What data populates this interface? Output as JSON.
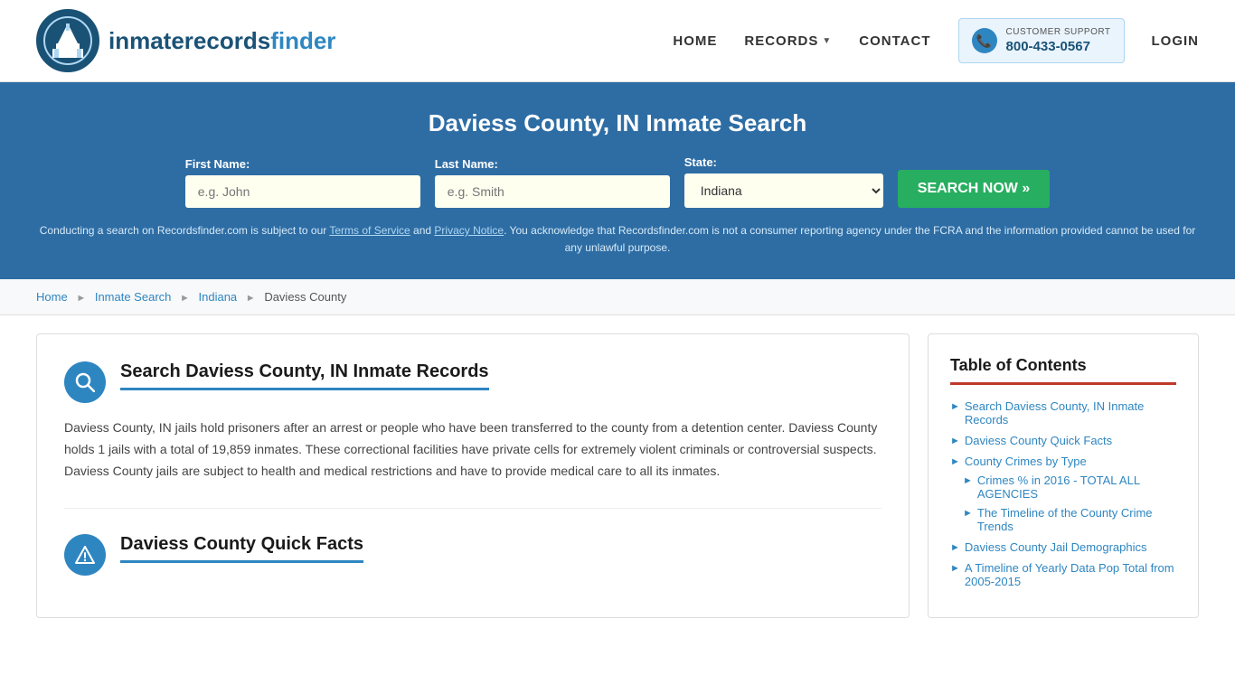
{
  "header": {
    "logo_text_part1": "inmaterecords",
    "logo_text_part2": "finder",
    "nav": {
      "home_label": "HOME",
      "records_label": "RECORDS",
      "contact_label": "CONTACT",
      "support_label": "CUSTOMER SUPPORT",
      "support_number": "800-433-0567",
      "login_label": "LOGIN"
    }
  },
  "search_banner": {
    "title": "Daviess County, IN Inmate Search",
    "first_name_label": "First Name:",
    "first_name_placeholder": "e.g. John",
    "last_name_label": "Last Name:",
    "last_name_placeholder": "e.g. Smith",
    "state_label": "State:",
    "state_value": "Indiana",
    "search_btn_label": "SEARCH NOW »",
    "disclaimer": "Conducting a search on Recordsfinder.com is subject to our Terms of Service and Privacy Notice. You acknowledge that Recordsfinder.com is not a consumer reporting agency under the FCRA and the information provided cannot be used for any unlawful purpose."
  },
  "breadcrumb": {
    "home": "Home",
    "inmate_search": "Inmate Search",
    "indiana": "Indiana",
    "current": "Daviess County"
  },
  "content": {
    "section1": {
      "title": "Search Daviess County, IN Inmate Records",
      "body": "Daviess County, IN jails hold prisoners after an arrest or people who have been transferred to the county from a detention center. Daviess County holds 1 jails with a total of 19,859 inmates. These correctional facilities have private cells for extremely violent criminals or controversial suspects. Daviess County jails are subject to health and medical restrictions and have to provide medical care to all its inmates."
    },
    "section2": {
      "title": "Daviess County Quick Facts"
    }
  },
  "sidebar": {
    "toc_title": "Table of Contents",
    "items": [
      {
        "label": "Search Daviess County, IN Inmate Records",
        "href": "#",
        "sub": []
      },
      {
        "label": "Daviess County Quick Facts",
        "href": "#",
        "sub": []
      },
      {
        "label": "County Crimes by Type",
        "href": "#",
        "sub": [
          {
            "label": "Crimes % in 2016 - TOTAL ALL AGENCIES",
            "href": "#"
          },
          {
            "label": "The Timeline of the County Crime Trends",
            "href": "#"
          }
        ]
      },
      {
        "label": "Daviess County Jail Demographics",
        "href": "#",
        "sub": []
      },
      {
        "label": "A Timeline of Yearly Data Pop Total from 2005-2015",
        "href": "#",
        "sub": []
      }
    ]
  }
}
